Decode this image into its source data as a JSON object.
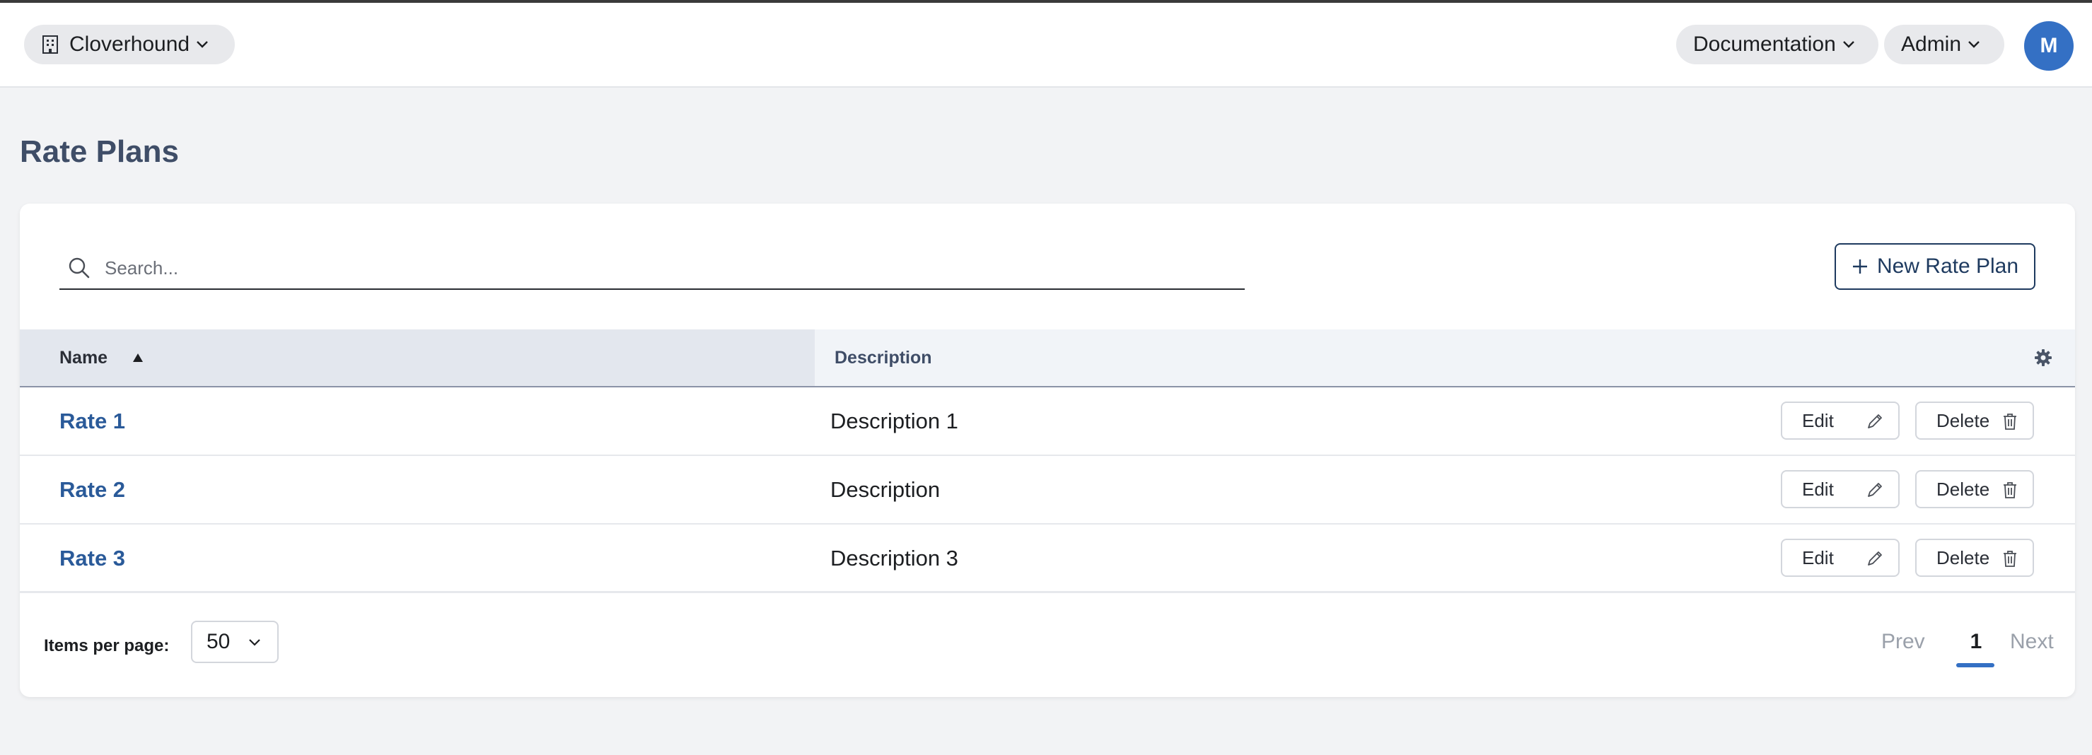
{
  "header": {
    "org_name": "Cloverhound",
    "docs_label": "Documentation",
    "admin_label": "Admin",
    "avatar_initial": "M"
  },
  "page": {
    "title": "Rate Plans"
  },
  "toolbar": {
    "search_placeholder": "Search...",
    "search_value": "",
    "new_button_label": "New Rate Plan"
  },
  "table": {
    "columns": [
      {
        "label": "Name",
        "sort": "ascending"
      },
      {
        "label": "Description"
      }
    ],
    "rows": [
      {
        "name": "Rate 1",
        "description": "Description 1",
        "edit_label": "Edit",
        "delete_label": "Delete"
      },
      {
        "name": "Rate 2",
        "description": "Description",
        "edit_label": "Edit",
        "delete_label": "Delete"
      },
      {
        "name": "Rate 3",
        "description": "Description 3",
        "edit_label": "Edit",
        "delete_label": "Delete"
      }
    ]
  },
  "pagination": {
    "items_per_page_label": "Items per page:",
    "items_per_page_value": "50",
    "prev_label": "Prev",
    "current_page": "1",
    "next_label": "Next"
  },
  "icons": {
    "org": "building-icon",
    "dropdown": "chevron-down-icon",
    "search": "search-icon",
    "add": "plus-icon",
    "sort": "sort-ascending-icon",
    "settings": "gear-icon",
    "edit": "pencil-icon",
    "delete": "trash-icon"
  },
  "colors": {
    "accent": "#3470c4",
    "link": "#2a5a99",
    "title": "#3f4d67",
    "primary_outline": "#1e3a5f"
  }
}
